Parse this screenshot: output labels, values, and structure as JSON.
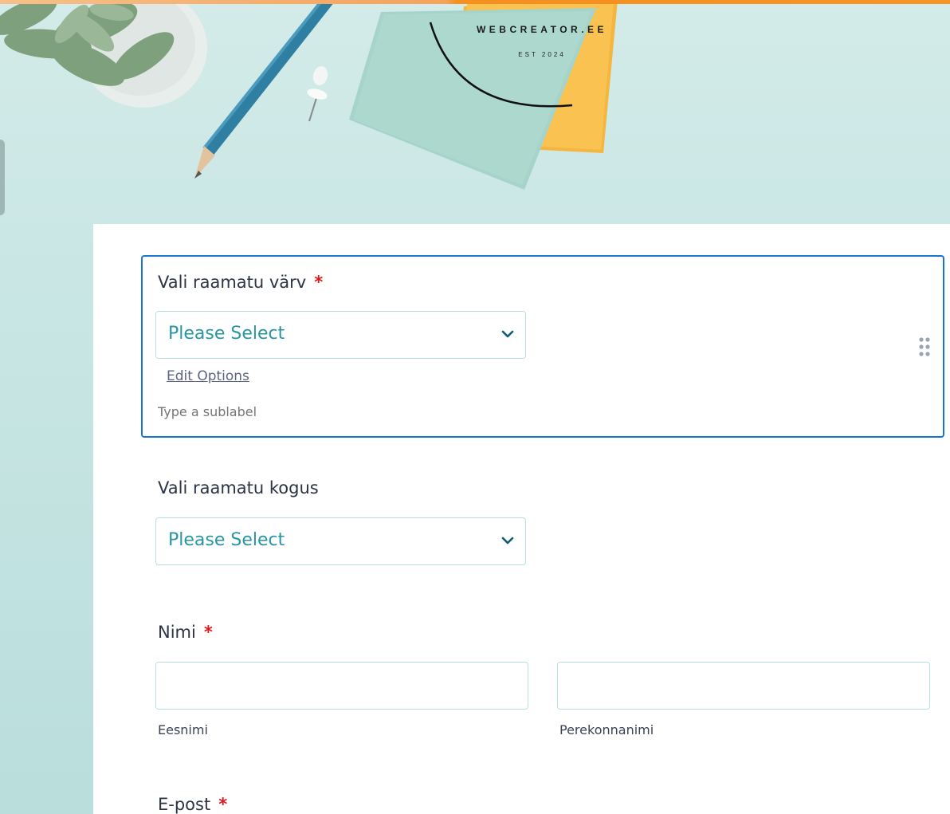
{
  "header": {
    "logo_name": "WEBCREATOR.EE",
    "logo_est": "EST 2024"
  },
  "form": {
    "fields": [
      {
        "label": "Vali raamatu värv",
        "required_mark": "*",
        "select_value": "Please Select",
        "edit_options_label": "Edit Options",
        "sublabel_placeholder": "Type a sublabel"
      },
      {
        "label": "Vali raamatu kogus",
        "select_value": "Please Select"
      },
      {
        "label": "Nimi",
        "required_mark": "*",
        "first_name_sublabel": "Eesnimi",
        "last_name_sublabel": "Perekonnanimi"
      },
      {
        "label": "E-post",
        "required_mark": "*"
      }
    ]
  },
  "colors": {
    "accent": "#1a74d1",
    "select_text": "#2896a4",
    "required": "#e2151a",
    "top_stripe": "#f6901f"
  },
  "icons": [
    "chevron-down-icon",
    "drag-handle-icon",
    "succulent-plant",
    "pencil",
    "push-pin",
    "sticky-notes"
  ]
}
